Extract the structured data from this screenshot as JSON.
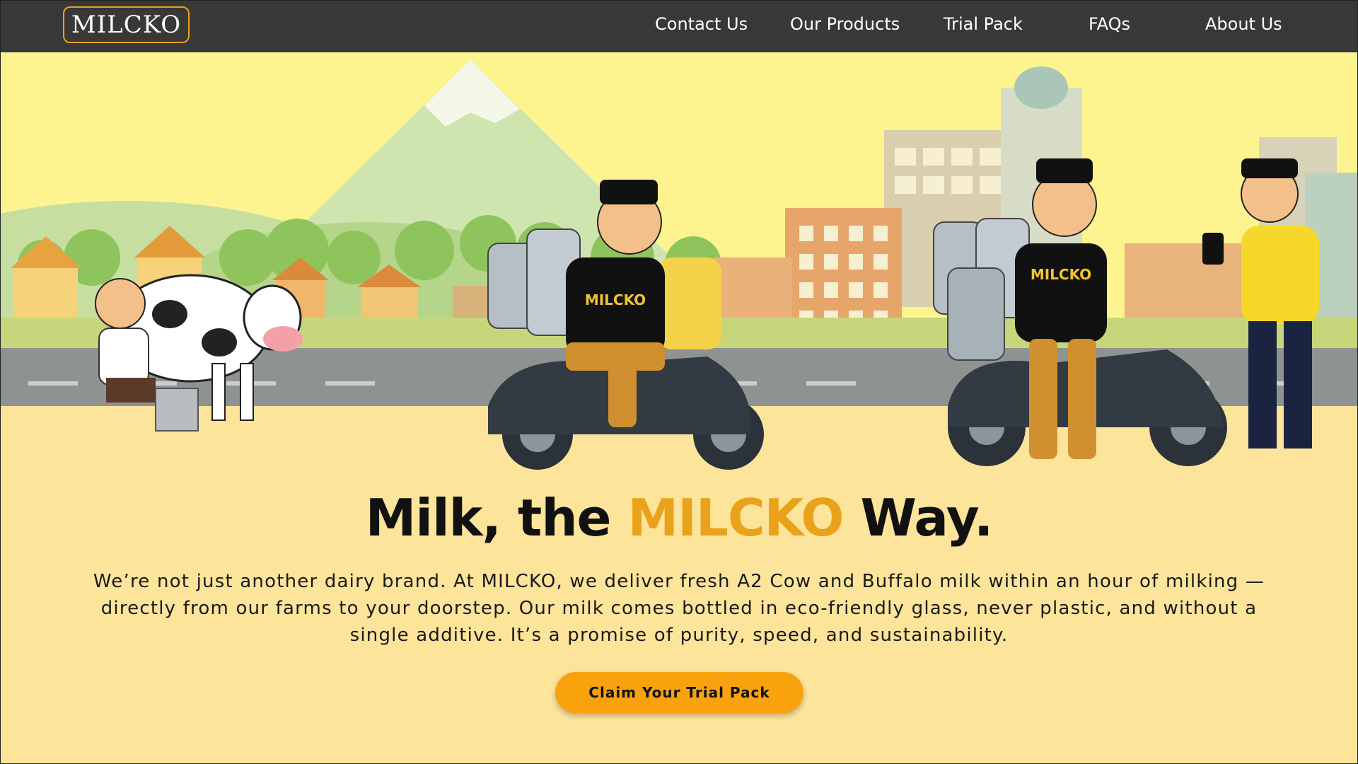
{
  "nav": {
    "logo": "MILCKO",
    "links": [
      {
        "label": "Contact Us"
      },
      {
        "label": "Our Products"
      },
      {
        "label": "Trial Pack"
      },
      {
        "label": "FAQs"
      },
      {
        "label": "About Us"
      }
    ]
  },
  "hero": {
    "illustration_text": {
      "shirt_left": "MILCKO",
      "shirt_right": "MILCKO"
    },
    "headline_pre": "Milk, the ",
    "headline_brand": "MILCKO",
    "headline_post": " Way.",
    "description": "We’re not just another dairy brand. At MILCKO, we deliver fresh A2 Cow and Buffalo milk within an hour of milking — directly from our farms to your doorstep. Our milk comes bottled in eco-friendly glass, never plastic, and without a single additive. It’s a promise of purity, speed, and sustainability.",
    "cta_label": "Claim Your Trial Pack"
  },
  "colors": {
    "nav_bg": "#383838",
    "accent": "#e9a21a",
    "cta": "#f9a20e",
    "page_bg": "#fde49b",
    "sky": "#fdf48f"
  }
}
